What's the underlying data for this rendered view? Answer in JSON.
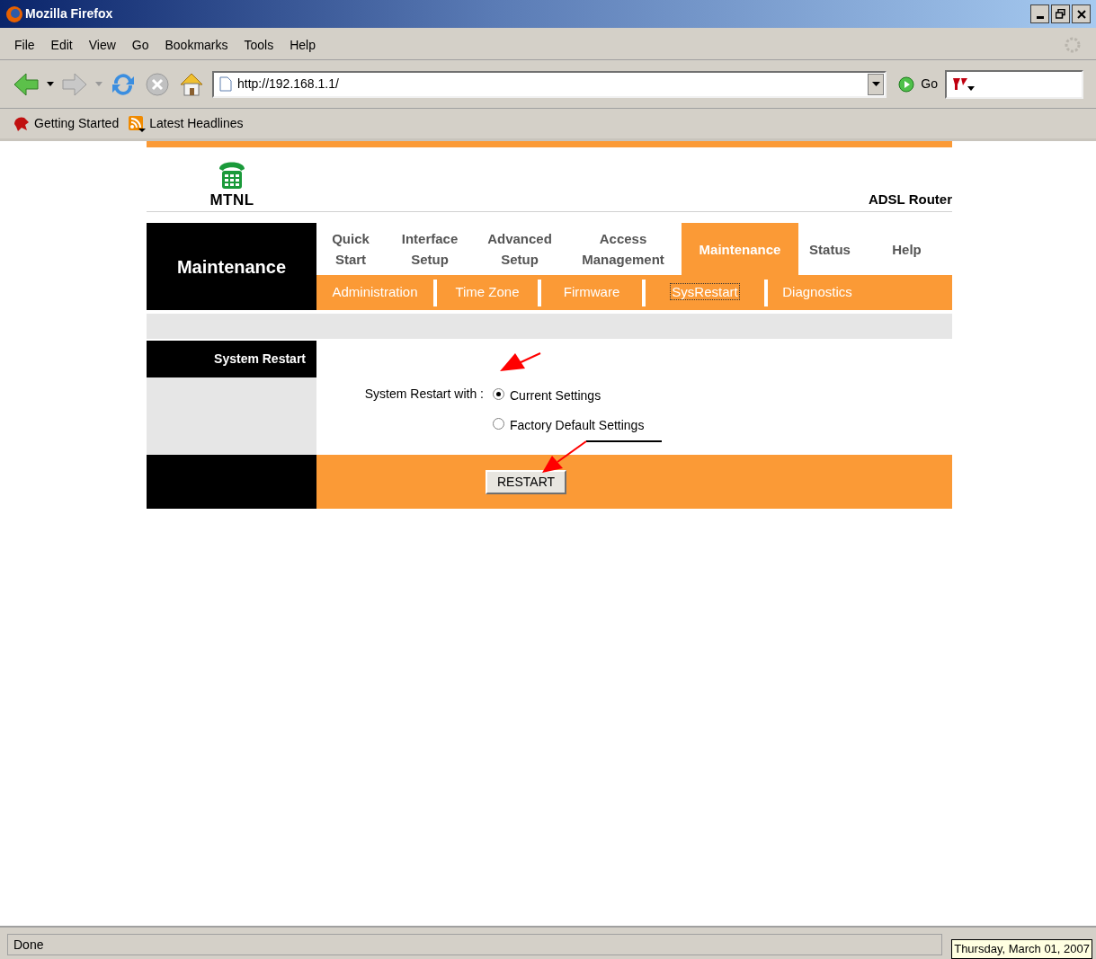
{
  "window": {
    "title": "Mozilla Firefox"
  },
  "menu": [
    "File",
    "Edit",
    "View",
    "Go",
    "Bookmarks",
    "Tools",
    "Help"
  ],
  "address": {
    "value": "http://192.168.1.1/"
  },
  "go_button": "Go",
  "bookmarks": [
    "Getting Started",
    "Latest Headlines"
  ],
  "page": {
    "brand": "MTNL",
    "product": "ADSL Router",
    "section_title": "Maintenance",
    "tabs": [
      {
        "label": "Quick\nStart",
        "selected": false
      },
      {
        "label": "Interface\nSetup",
        "selected": false
      },
      {
        "label": "Advanced\nSetup",
        "selected": false
      },
      {
        "label": "Access\nManagement",
        "selected": false
      },
      {
        "label": "Maintenance",
        "selected": true
      },
      {
        "label": "Status",
        "selected": false
      },
      {
        "label": "Help",
        "selected": false
      }
    ],
    "subtabs": [
      {
        "label": "Administration",
        "selected": false
      },
      {
        "label": "Time Zone",
        "selected": false
      },
      {
        "label": "Firmware",
        "selected": false
      },
      {
        "label": "SysRestart",
        "selected": true
      },
      {
        "label": "Diagnostics",
        "selected": false
      }
    ],
    "form": {
      "sidebar_label": "System Restart",
      "field_label": "System Restart with :",
      "options": [
        {
          "label": "Current Settings",
          "selected": true
        },
        {
          "label": "Factory Default Settings",
          "selected": false
        }
      ],
      "button": "RESTART"
    }
  },
  "status_bar": {
    "text": "Done",
    "tooltip": "Thursday, March 01, 2007"
  }
}
